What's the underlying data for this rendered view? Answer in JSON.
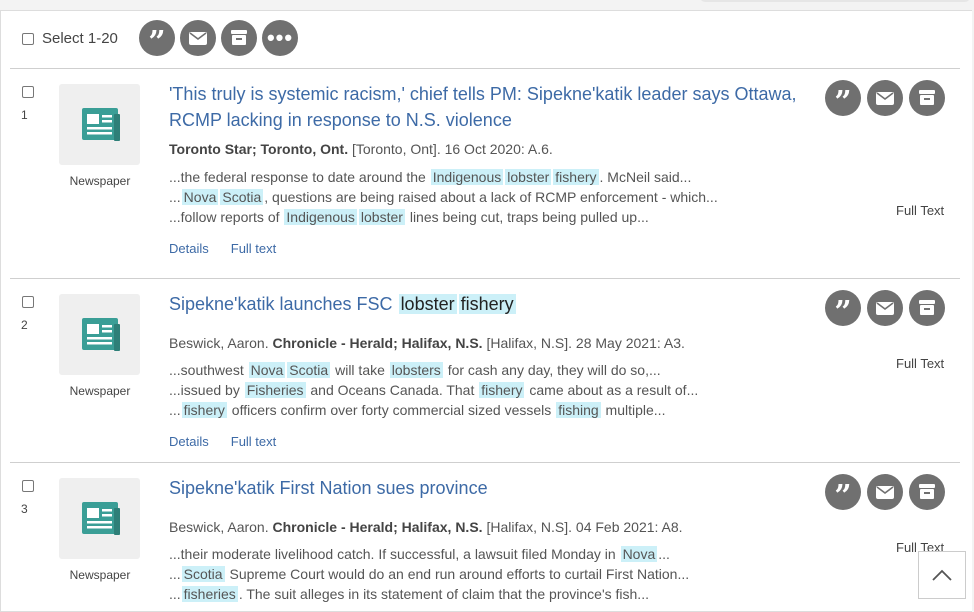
{
  "toolbar": {
    "select_label": "Select 1-20"
  },
  "doctype_label": "Newspaper",
  "details_label": "Details",
  "fulltext_link_label": "Full text",
  "fulltext_label": "Full Text",
  "results": [
    {
      "number": "1",
      "title": "'This truly is systemic racism,' chief tells PM: Sipekne'katik leader says Ottawa, RCMP lacking in response to N.S. violence",
      "cite_pub": "Toronto Star; Toronto, Ont.",
      "cite_rest": " [Toronto, Ont]. 16 Oct 2020: A.6.",
      "snippets": [
        "...the federal response to date around the ",
        "Indigenous",
        "lobster",
        "fishery",
        ". McNeil said...",
        "...",
        "Nova",
        "Scotia",
        ", questions are being raised about a lack of RCMP enforcement - which...",
        "...follow reports of ",
        "Indigenous",
        "lobster",
        " lines being cut, traps being pulled up..."
      ]
    },
    {
      "number": "2",
      "title": "Sipekne'katik launches FSC ",
      "title_hl": [
        "lobster",
        "fishery"
      ],
      "cite_author": "Beswick, Aaron.",
      "cite_pub": "Chronicle - Herald; Halifax, N.S.",
      "cite_rest": " [Halifax, N.S]. 28 May 2021: A3.",
      "snippets": [
        "...southwest ",
        "Nova",
        "Scotia",
        " will take ",
        "lobsters",
        " for cash any day, they will do so,...",
        "...issued by ",
        "Fisheries",
        " and Oceans Canada. That ",
        "fishery",
        " came about as a result of...",
        "...",
        "fishery",
        " officers confirm over forty commercial sized vessels ",
        "fishing",
        " multiple..."
      ]
    },
    {
      "number": "3",
      "title": "Sipekne'katik First Nation sues province",
      "cite_author": "Beswick, Aaron.",
      "cite_pub": "Chronicle - Herald; Halifax, N.S.",
      "cite_rest": " [Halifax, N.S]. 04 Feb 2021: A8.",
      "snippets": [
        "...their moderate livelihood catch. If successful, a lawsuit filed Monday in ",
        "Nova",
        "...",
        "...",
        "Scotia",
        " Supreme Court would do an end run around efforts to curtail First Nation...",
        "...",
        "fisheries",
        ". The suit alleges in its statement of claim that the province's fish..."
      ]
    }
  ],
  "colors": {
    "link": "#3d6aa6",
    "highlight": "#ccf0f8",
    "icon_circle": "#707070",
    "news_icon": "#2e8b84"
  },
  "icons": [
    "cite-icon",
    "email-icon",
    "save-icon",
    "more-icon",
    "newspaper-icon",
    "chevron-up-icon"
  ]
}
